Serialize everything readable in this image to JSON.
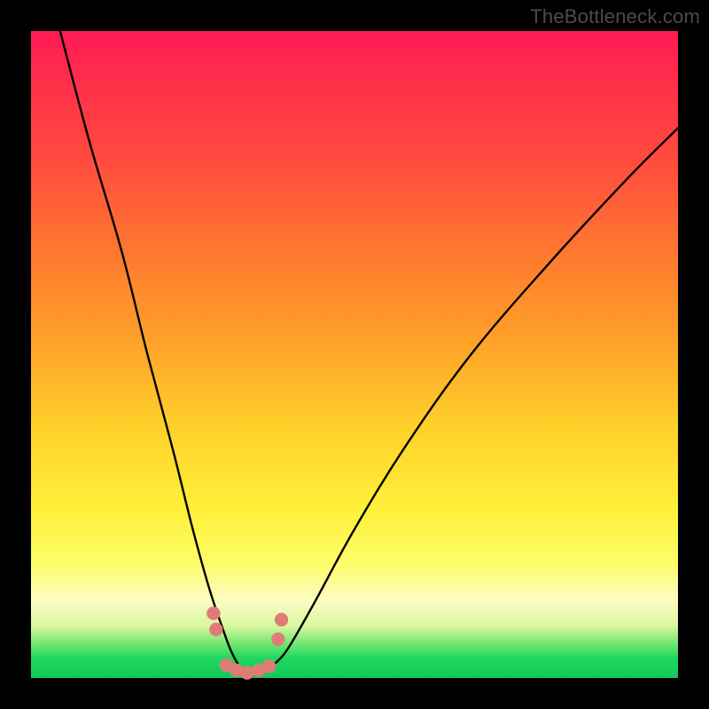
{
  "watermark": "TheBottleneck.com",
  "colors": {
    "frame": "#000000",
    "curve": "#000000",
    "marker_fill": "#e07c78",
    "marker_stroke": "#c95f5b"
  },
  "chart_data": {
    "type": "line",
    "title": "",
    "xlabel": "",
    "ylabel": "",
    "xlim": [
      0,
      100
    ],
    "ylim": [
      0,
      100
    ],
    "note": "No axis tick labels or numeric legend are visible. Percent-of-plot coordinates (0..100, y from top) are estimated from the image; the curve is a deep V-shaped bottleneck profile.",
    "series": [
      {
        "name": "curve",
        "x_pct": [
          4.5,
          9,
          14,
          18,
          22,
          25,
          27.5,
          29.5,
          31,
          32.5,
          34,
          36,
          38,
          40,
          44,
          50,
          58,
          68,
          80,
          92,
          100
        ],
        "y_pct": [
          0,
          17,
          34,
          50,
          65,
          77,
          86,
          92,
          96,
          98.5,
          99.3,
          98.8,
          97.5,
          95,
          88,
          77,
          64,
          50,
          36,
          23,
          15
        ]
      }
    ],
    "markers": {
      "name": "valley-markers",
      "x_pct": [
        28.2,
        28.6,
        30.2,
        31.8,
        33.4,
        35.2,
        36.8,
        38.2,
        38.7
      ],
      "y_pct": [
        90.0,
        92.5,
        98.0,
        98.8,
        99.2,
        98.8,
        98.2,
        94.0,
        91.0
      ],
      "r_pct": 1.05
    }
  }
}
